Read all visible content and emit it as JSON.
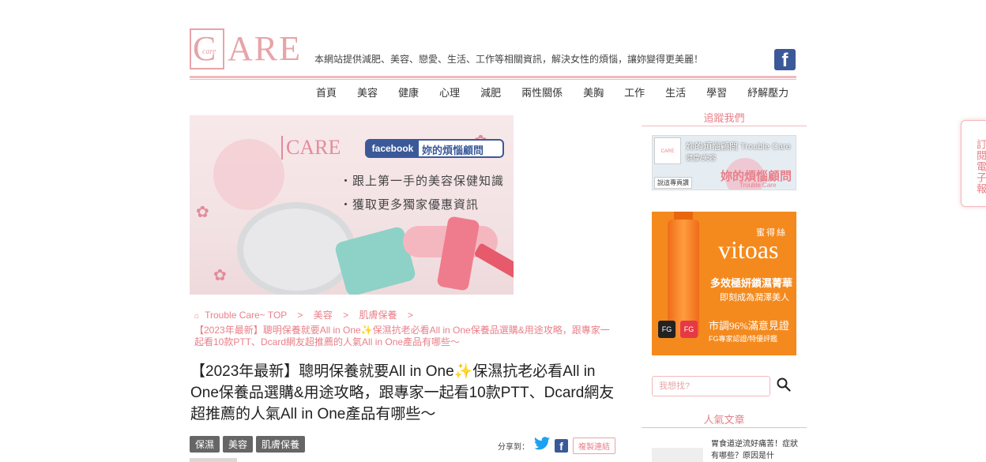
{
  "header": {
    "logo_small": "care",
    "logo_text": "ARE",
    "logo_c": "C",
    "tagline": "本網站提供減肥、美容、戀愛、生活、工作等相關資訊，解決女性的煩惱，讓妳變得更美麗！",
    "fb_icon": "facebook-icon"
  },
  "nav": {
    "items": [
      "首頁",
      "美容",
      "健康",
      "心理",
      "減肥",
      "兩性關係",
      "美胸",
      "工作",
      "生活",
      "學習",
      "紓解壓力"
    ]
  },
  "banner": {
    "care_text": "CARE",
    "fb_word": "facebook",
    "fb_title": "妳的煩惱顧問",
    "line1": "・跟上第一手的美容保健知識",
    "line2": "・獲取更多獨家優惠資訊"
  },
  "breadcrumb": {
    "home": "Trouble Care~ TOP",
    "cat1": "美容",
    "cat2": "肌膚保養",
    "current": "【2023年最新】聰明保養就要All in One✨保濕抗老必看All in One保養品選購&用途攻略，跟專家一起看10款PTT、Dcard網友超推薦的人氣All in One產品有哪些～"
  },
  "article": {
    "title": "【2023年最新】聰明保養就要All in One✨保濕抗老必看All in One保養品選購&用途攻略，跟專家一起看10款PTT、Dcard網友超推薦的人氣All in One產品有哪些～",
    "tags": [
      "保濕",
      "美容",
      "肌膚保養"
    ],
    "share_label": "分享到：",
    "copy_label": "複製連結"
  },
  "sidebar": {
    "follow_head": "追蹤我們",
    "fb_page_name": "妳的煩惱顧問 Trouble Care",
    "fb_page_sub": "健康/美容",
    "fb_like": "說這專頁讚",
    "fb_pink_logo": "妳的煩惱顧問",
    "fb_tc": "Trouble Care",
    "ad_cn": "蜜得絲",
    "ad_brand": "vitoas",
    "ad_line1": "多效極妍鎖濕菁華",
    "ad_line2": "即刻成為潤澤美人",
    "ad_line3": "市調96%滿意見證",
    "ad_line4": "FG專家認證/特優評鑑",
    "ad_fg": "FG",
    "search_placeholder": "我想找?",
    "popular_head": "人氣文章",
    "popular_text": "胃食道逆流好痛苦！症狀有哪些？原因是什"
  },
  "subscribe": {
    "label": "訂閱電子報"
  },
  "colors": {
    "accent": "#e8808a",
    "rule": "#f1b9bd",
    "facebook": "#3b5998",
    "twitter": "#1da1f2",
    "ad_orange": "#f48a1e"
  }
}
